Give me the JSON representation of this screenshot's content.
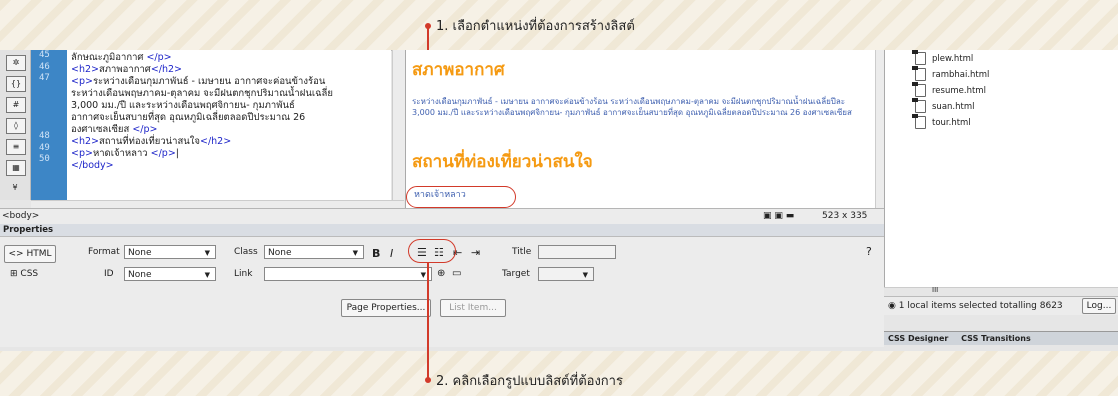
{
  "annotations": {
    "top": "1. เลือกตำแหน่งที่ต้องการสร้างลิสต์",
    "bottom": "2. คลิกเลือกรูปแบบลิสต์ที่ต้องการ"
  },
  "code_view": {
    "line_numbers": [
      "45",
      "46",
      "47",
      "",
      "",
      "",
      "",
      "48",
      "49",
      "50"
    ],
    "lines": [
      {
        "text": "ลักษณะภูมิอากาศ ",
        "tag_after": "</p>"
      },
      {
        "tag_before": "<h2>",
        "text": "สภาพอากาศ",
        "tag_after": "</h2>"
      },
      {
        "tag_before": "<p>",
        "text": "ระหว่างเดือนกุมภาพันธ์ - เมษายน อากาศจะค่อนข้างร้อน"
      },
      {
        "text": "ระหว่างเดือนพฤษภาคม-ตุลาคม จะมีฝนตกชุกปริมาณน้ำฝนเฉลี่ย"
      },
      {
        "text": "3,000 มม./ปี และระหว่างเดือนพฤศจิกายน- กุมภาพันธ์"
      },
      {
        "text": "อากาศจะเย็นสบายที่สุด อุณหภูมิเฉลี่ยตลอดปีประมาณ 26"
      },
      {
        "text": "องศาเซลเซียส ",
        "tag_after": "</p>"
      },
      {
        "tag_before": "<h2>",
        "text": "สถานที่ท่องเที่ยวน่าสนใจ",
        "tag_after": "</h2>"
      },
      {
        "tag_before": "<p>",
        "text": "หาดเจ้าหลาว ",
        "tag_after": "</p>"
      },
      {
        "text": "</body>"
      }
    ]
  },
  "design_view": {
    "heading1": "สภาพอากาศ",
    "paragraph": "ระหว่างเดือนกุมภาพันธ์ - เมษายน อากาศจะค่อนข้างร้อน ระหว่างเดือนพฤษภาคม-ตุลาคม จะมีฝนตกชุกปริมาณน้ำฝนเฉลี่ยปีละ 3,000 มม./ปี และระหว่างเดือนพฤศจิกายน- กุมภาพันธ์ อากาศจะเย็นสบายที่สุด อุณหภูมิเฉลี่ยตลอดปีประมาณ 26 องศาเซลเซียส",
    "heading2": "สถานที่ท่องเที่ยวน่าสนใจ",
    "selected_item": "หาดเจ้าหลาว"
  },
  "status_bar": {
    "tag": "<body>",
    "window_size": "523 x 335"
  },
  "properties": {
    "title": "Properties",
    "html_btn": "HTML",
    "css_btn": "CSS",
    "format_label": "Format",
    "format_value": "None",
    "id_label": "ID",
    "id_value": "None",
    "class_label": "Class",
    "class_value": "None",
    "link_label": "Link",
    "title_label": "Title",
    "target_label": "Target",
    "bold": "B",
    "italic": "I",
    "page_properties": "Page Properties...",
    "list_item": "List Item..."
  },
  "files_panel": {
    "files": [
      "plew.html",
      "rambhai.html",
      "resume.html",
      "suan.html",
      "tour.html"
    ],
    "status": "1 local items selected totalling 8623",
    "log_btn": "Log...",
    "scroll_label": "III"
  },
  "tabs": [
    "CSS Designer",
    "CSS Transitions"
  ]
}
